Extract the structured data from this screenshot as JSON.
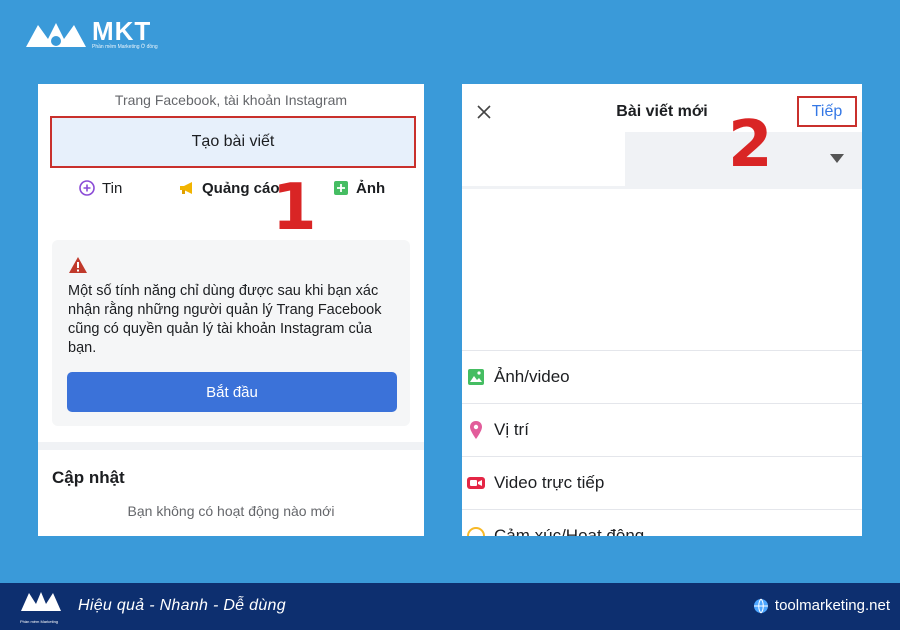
{
  "brand": {
    "name": "MKT",
    "tagline": "Phần mềm Marketing Ở đồng",
    "footer_tagline": "Phần mềm Marketing",
    "slogan": "Hiệu quả - Nhanh  - Dễ dùng",
    "website": "toolmarketing.net",
    "colors": {
      "background": "#3a9ad9",
      "footer": "#0d2f6f",
      "highlight": "#c9302c",
      "step_number": "#d92525"
    }
  },
  "left_panel": {
    "header": "Trang Facebook, tài khoản Instagram",
    "create_post_label": "Tạo bài viết",
    "actions": [
      {
        "label": "Tin",
        "icon": "plus-circle-icon"
      },
      {
        "label": "Quảng cáo",
        "icon": "megaphone-icon"
      },
      {
        "label": "Ảnh",
        "icon": "photo-icon"
      }
    ],
    "step_number": "1",
    "warning_text": "Một số tính năng chỉ dùng được sau khi bạn xác nhận rằng những người quản lý Trang Facebook cũng có quyền quản lý tài khoản Instagram của bạn.",
    "start_button": "Bắt đầu",
    "updates_title": "Cập nhật",
    "updates_empty": "Bạn không có hoạt động nào mới"
  },
  "right_panel": {
    "title": "Bài viết mới",
    "next_button": "Tiếp",
    "step_number": "2",
    "options": [
      {
        "label": "Ảnh/video",
        "icon": "photo-video-icon"
      },
      {
        "label": "Vị trí",
        "icon": "location-pin-icon"
      },
      {
        "label": "Video trực tiếp",
        "icon": "live-video-icon"
      },
      {
        "label": "Cảm xúc/Hoạt động",
        "icon": "emoji-icon"
      }
    ]
  }
}
